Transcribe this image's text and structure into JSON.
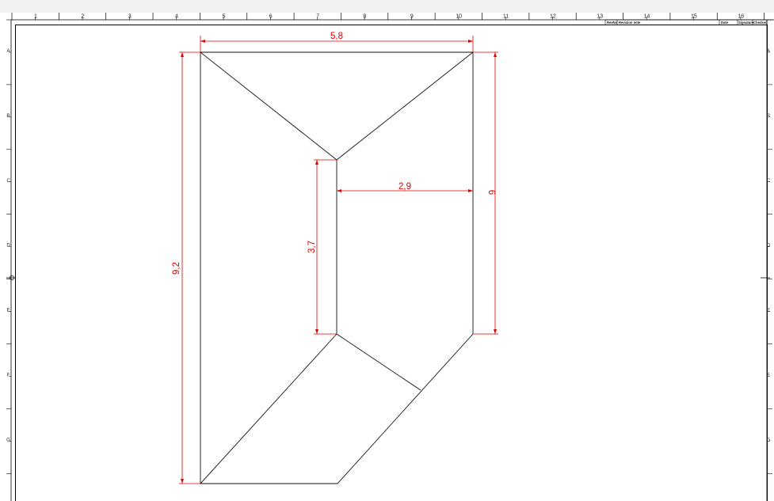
{
  "sheet": {
    "column_numbers": [
      "1",
      "2",
      "3",
      "4",
      "5",
      "6",
      "7",
      "8",
      "9",
      "10",
      "11",
      "12",
      "13",
      "14",
      "15",
      "16"
    ],
    "row_letters": [
      "A",
      "B",
      "C",
      "D",
      "E",
      "F",
      "G"
    ]
  },
  "title_block": {
    "rev_no": "RevNo",
    "revision_note": "Revision note",
    "date": "Date",
    "signature": "Signature",
    "checked": "Checked"
  },
  "dimensions": {
    "top_width": "5,8",
    "right_offset": "2,9",
    "right_height": "6",
    "inner_height": "3,7",
    "total_height": "9,2"
  },
  "colors": {
    "dimension": "#e00000",
    "geometry": "#111111",
    "frame": "#000000"
  }
}
